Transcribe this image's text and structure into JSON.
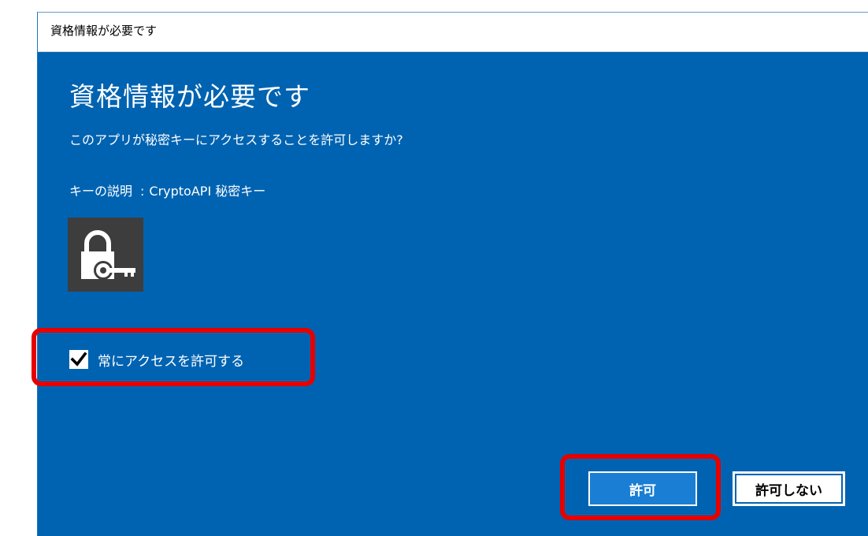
{
  "window": {
    "title": "資格情報が必要です"
  },
  "dialog": {
    "heading": "資格情報が必要です",
    "question": "このアプリが秘密キーにアクセスすることを許可しますか?",
    "key_label": "キーの説明",
    "key_separator": ":",
    "key_value": "CryptoAPI 秘密キー",
    "icon": "lock-key-icon",
    "checkbox": {
      "label": "常にアクセスを許可する",
      "checked": true
    },
    "buttons": {
      "allow": "許可",
      "deny": "許可しない"
    }
  },
  "colors": {
    "dialog_background": "#0063b1",
    "icon_tile": "#3d3d3d",
    "allow_button": "#1a7fd4",
    "highlight": "#e60000"
  }
}
